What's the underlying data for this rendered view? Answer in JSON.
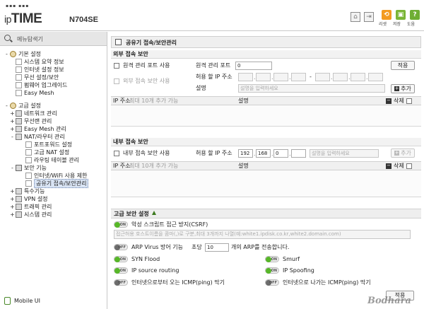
{
  "header": {
    "logo_prefix": "ip",
    "logo_main": "TIME",
    "model": "N704SE",
    "icons": [
      "home-icon",
      "logout-icon"
    ],
    "buttons": [
      {
        "label": "리셋",
        "icon": "reset-icon",
        "color": "#f39a1e"
      },
      {
        "label": "저장",
        "icon": "save-icon",
        "color": "#7ab536"
      },
      {
        "label": "도움",
        "icon": "help-icon",
        "color": "#6fae34"
      }
    ]
  },
  "sidebar": {
    "search_label": "메뉴탐색기",
    "mobile_label": "Mobile UI",
    "tree": [
      {
        "label": "기본 설정",
        "level": 0,
        "toggle": "-",
        "icon": "gear"
      },
      {
        "label": "시스템 요약 정보",
        "level": 1,
        "toggle": "",
        "icon": "doc"
      },
      {
        "label": "인터넷 설정 정보",
        "level": 1,
        "toggle": "",
        "icon": "doc"
      },
      {
        "label": "무선 설정/보안",
        "level": 1,
        "toggle": "",
        "icon": "doc"
      },
      {
        "label": "펌웨어 업그레이드",
        "level": 1,
        "toggle": "",
        "icon": "doc"
      },
      {
        "label": "Easy Mesh",
        "level": 1,
        "toggle": "",
        "icon": "doc"
      },
      {
        "label": "고급 설정",
        "level": 0,
        "toggle": "-",
        "icon": "gear"
      },
      {
        "label": "네트워크 관리",
        "level": 1,
        "toggle": "+",
        "icon": "folder"
      },
      {
        "label": "무선랜 관리",
        "level": 1,
        "toggle": "+",
        "icon": "folder"
      },
      {
        "label": "Easy Mesh 관리",
        "level": 1,
        "toggle": "+",
        "icon": "folder"
      },
      {
        "label": "NAT/라우터 관리",
        "level": 1,
        "toggle": "-",
        "icon": "folder"
      },
      {
        "label": "포트포워드 설정",
        "level": 2,
        "toggle": "",
        "icon": "doc"
      },
      {
        "label": "고급 NAT 설정",
        "level": 2,
        "toggle": "",
        "icon": "doc"
      },
      {
        "label": "라우팅 테이블 관리",
        "level": 2,
        "toggle": "",
        "icon": "doc"
      },
      {
        "label": "보안 기능",
        "level": 1,
        "toggle": "-",
        "icon": "lock"
      },
      {
        "label": "인터넷/WiFi 사용 제한",
        "level": 2,
        "toggle": "",
        "icon": "doc"
      },
      {
        "label": "공유기 접속/보안관리",
        "level": 2,
        "toggle": "",
        "icon": "doc",
        "active": true
      },
      {
        "label": "특수기능",
        "level": 1,
        "toggle": "+",
        "icon": "folder"
      },
      {
        "label": "VPN 설정",
        "level": 1,
        "toggle": "+",
        "icon": "folder"
      },
      {
        "label": "트래픽 관리",
        "level": 1,
        "toggle": "+",
        "icon": "folder"
      },
      {
        "label": "시스템 관리",
        "level": 1,
        "toggle": "+",
        "icon": "folder"
      }
    ]
  },
  "main": {
    "title": "공유기 접속/보안관리",
    "external": {
      "heading": "외부 접속 보안",
      "remote_port_use_label": "원격 관리 포트 사용",
      "remote_port_label": "원격 관리 포트",
      "remote_port_value": "0",
      "apply_label": "적용",
      "external_access_use_label": "외부 접속 보안 사용",
      "allowed_ip_label": "허용 할 IP 주소",
      "dash": "-",
      "description_label": "설명",
      "description_placeholder": "설명을 입력하세요",
      "add_label": "추가",
      "list_ip_header": "IP 주소",
      "list_ip_hint": "최대 10개 추가 가능",
      "list_desc_header": "설명",
      "list_delete_label": "삭제"
    },
    "internal": {
      "heading": "내부 접속 보안",
      "internal_access_use_label": "내부 접속 보안 사용",
      "allowed_ip_label": "허용 할 IP 주소",
      "ip_octets": [
        "192",
        "168",
        "0",
        ""
      ],
      "description_placeholder": "설명을 입력하세요",
      "add_label": "추가",
      "list_ip_header": "IP 주소",
      "list_ip_hint": "최대 10개 추가 가능",
      "list_desc_header": "설명",
      "list_delete_label": "삭제"
    },
    "advanced": {
      "heading": "고급 보안 설정",
      "csrf_label": "악성 스크립트 접근 방지(CSRF)",
      "csrf_state": "on",
      "hosts_placeholder": "접근허용 호스트이름을 콤마(,)로 구분,최대 3개까지 나열(예:white1.ipdisk.co.kr,white2.domain.com)",
      "arp_label": "ARP Virus 방어 기능",
      "arp_state": "off",
      "arp_per_sec_prefix": "초당",
      "arp_per_sec_value": "10",
      "arp_per_sec_suffix": "개의 ARP를 전송합니다.",
      "toggles": [
        {
          "label": "SYN Flood",
          "state": "on"
        },
        {
          "label": "Smurf",
          "state": "on"
        },
        {
          "label": "IP source routing",
          "state": "on"
        },
        {
          "label": "IP Spoofing",
          "state": "on"
        },
        {
          "label": "인터넷으로부터 오는 ICMP(ping) 막기",
          "state": "off"
        },
        {
          "label": "인터넷으로 나가는 ICMP(ping) 막기",
          "state": "off"
        }
      ],
      "on_text": "ON",
      "off_text": "OFF",
      "apply_label": "적용"
    }
  },
  "watermark": "Bodhara"
}
